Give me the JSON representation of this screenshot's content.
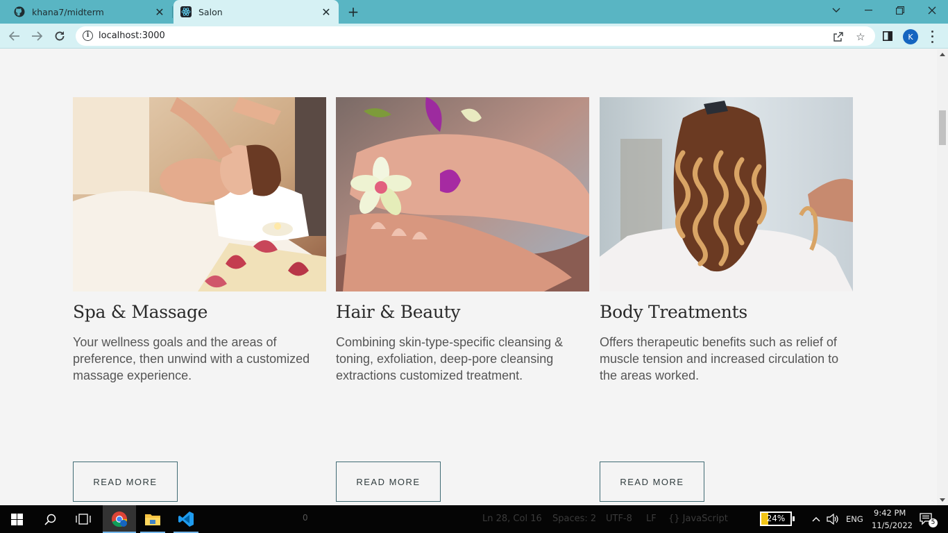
{
  "browser": {
    "tabs": [
      {
        "title": "khana7/midterm",
        "icon": "github-icon",
        "active": false
      },
      {
        "title": "Salon",
        "icon": "react-icon",
        "active": true
      }
    ],
    "url": "localhost:3000",
    "profile_initial": "K"
  },
  "page": {
    "cards": [
      {
        "title": "Spa & Massage",
        "description": "Your wellness goals and the areas of preference, then unwind with a customized massage experience.",
        "button": "READ MORE",
        "image": "spa-massage-photo"
      },
      {
        "title": "Hair & Beauty",
        "description": "Combining skin-type-specific cleansing & toning, exfoliation, deep-pore cleansing extractions customized treatment.",
        "button": "READ MORE",
        "image": "foot-care-photo"
      },
      {
        "title": "Body Treatments",
        "description": "Offers therapeutic benefits such as relief of muscle tension and increased circulation to the areas worked.",
        "button": "READ MORE",
        "image": "hair-styling-photo"
      }
    ]
  },
  "taskbar": {
    "background_text": [
      "Ln 28, Col 16",
      "Spaces: 2",
      "UTF-8",
      "LF",
      "{} JavaScript"
    ],
    "explorer_badge": "0",
    "battery_percent": "24%",
    "battery_level": 0.24,
    "language": "ENG",
    "time": "9:42 PM",
    "date": "11/5/2022",
    "notification_count": "5"
  },
  "colors": {
    "tabstrip": "#59b5c3",
    "toolbar": "#d6f1f4",
    "page_bg": "#f4f4f4",
    "button_border": "#3f6a73"
  }
}
